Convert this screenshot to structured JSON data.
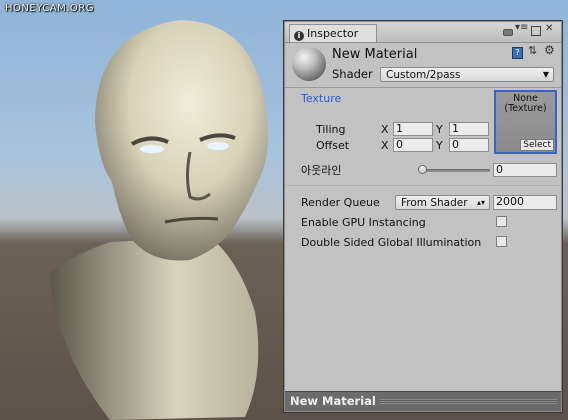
{
  "watermark": "HONEYCAM.ORG",
  "inspector": {
    "tab_label": "Inspector",
    "material_name": "New Material",
    "shader_label": "Shader",
    "shader_value": "Custom/2pass",
    "texture": {
      "label": "Texture",
      "slot_text": "None\n(Texture)",
      "select_label": "Select",
      "tiling_label": "Tiling",
      "offset_label": "Offset",
      "x_label": "X",
      "y_label": "Y",
      "tiling_x": "1",
      "tiling_y": "1",
      "offset_x": "0",
      "offset_y": "0"
    },
    "outline": {
      "label": "아웃라인",
      "value": "0",
      "slider_fraction": 0
    },
    "render_queue": {
      "label": "Render Queue",
      "dropdown": "From Shader",
      "value": "2000"
    },
    "gpu_instancing_label": "Enable GPU Instancing",
    "double_sided_label": "Double Sided Global Illumination",
    "footer_title": "New Material"
  },
  "colors": {
    "accent": "#3d62c7",
    "label_blue": "#2a5fd6",
    "panel_bg": "#c2c2c2"
  }
}
